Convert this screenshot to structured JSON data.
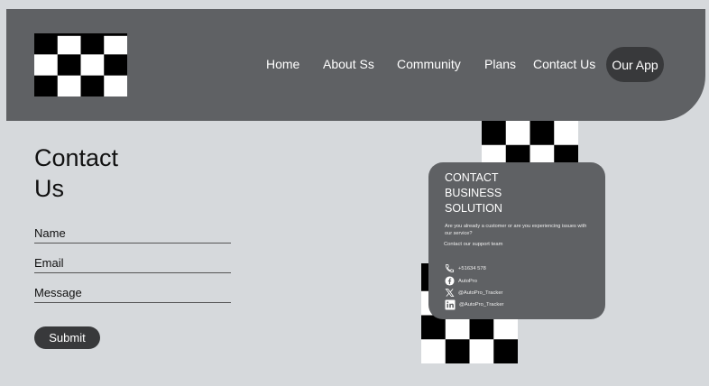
{
  "header": {
    "nav": [
      "Home",
      "About Ss",
      "Community",
      "Plans",
      "Contact Us"
    ],
    "app_button": "Our App"
  },
  "form": {
    "title_line1": "Contact",
    "title_line2": "Us",
    "name_label": "Name",
    "email_label": "Email",
    "message_label": "Message",
    "submit_label": "Submit"
  },
  "card": {
    "title_line1": "CONTACT",
    "title_line2": "BUSINESS",
    "title_line3": "SOLUTION",
    "description": "Are you already a customer or are you experiencing issues with our service?",
    "support": "Contact our support team",
    "phone": "+51634 578",
    "facebook": "AutoPro",
    "x": "@AutoPro_Tracker",
    "linkedin": "@AutoPro_Tracker"
  },
  "colors": {
    "page_bg": "#d6d9dc",
    "header_bg": "#5f6164",
    "button_dark": "#38393b",
    "card_bg": "#5f6164"
  },
  "icons": [
    "checkerboard-logo",
    "phone-icon",
    "facebook-icon",
    "x-icon",
    "linkedin-icon"
  ]
}
